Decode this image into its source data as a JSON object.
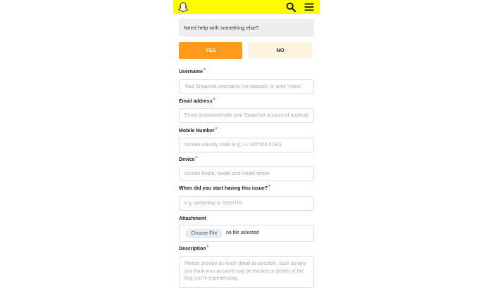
{
  "header": {
    "background_color": "#FFFC00",
    "logo_icon": "snapchat-ghost-icon",
    "search_icon": "search-icon",
    "menu_icon": "hamburger-menu-icon"
  },
  "help_prompt": {
    "question": "Need help with something else?",
    "yes_label": "YES",
    "no_label": "NO",
    "yes_color": "#FF9A1A",
    "no_color": "#FFF4E0"
  },
  "form": {
    "required_marker": "*",
    "username": {
      "label": "Username",
      "placeholder": "Your Snapchat username (no spaces), or write \"none\""
    },
    "email": {
      "label": "Email address",
      "placeholder": "Email associated with your Snapchat account (if applicable)"
    },
    "mobile": {
      "label": "Mobile Number",
      "placeholder": "Include country code (e.g. +1 202 555 0192)"
    },
    "device": {
      "label": "Device",
      "placeholder": "Include brand, model and model series"
    },
    "issue_start": {
      "label": "When did you start having this issue?",
      "placeholder": "e.g. yesterday or 31/01/16"
    },
    "attachment": {
      "label": "Attachment",
      "button_label": "Choose File",
      "status": "no file selected"
    },
    "description": {
      "label": "Description",
      "placeholder": "Please provide as much detail as possible, such as why you think your account may be hacked or details of the bug you're experiencing."
    }
  }
}
